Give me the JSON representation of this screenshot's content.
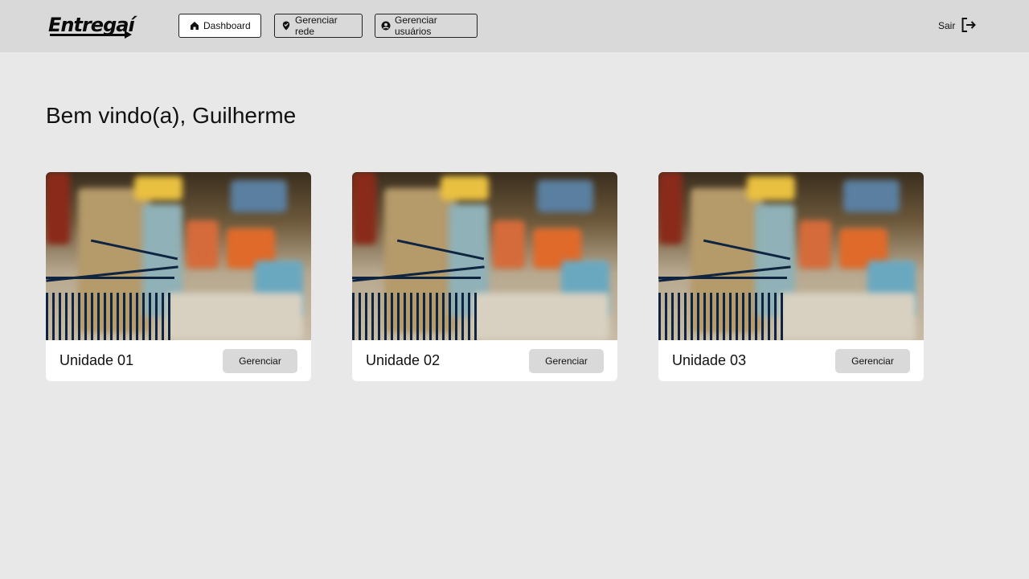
{
  "header": {
    "logo_text": "Entregaí",
    "nav": {
      "dashboard": "Dashboard",
      "manage_network": "Gerenciar rede",
      "manage_users": "Gerenciar usuários"
    },
    "logout_label": "Sair"
  },
  "main": {
    "welcome": "Bem vindo(a), Guilherme",
    "units": [
      {
        "name": "Unidade 01",
        "button": "Gerenciar"
      },
      {
        "name": "Unidade 02",
        "button": "Gerenciar"
      },
      {
        "name": "Unidade 03",
        "button": "Gerenciar"
      }
    ]
  },
  "colors": {
    "page_bg": "#e8e8e8",
    "header_bg": "#d9d9d9",
    "card_bg": "#ffffff",
    "button_bg": "#d9d9d9"
  },
  "icons": {
    "dashboard": "home-icon",
    "manage_network": "map-pin-check-icon",
    "manage_users": "user-circle-icon",
    "logout": "logout-icon"
  }
}
